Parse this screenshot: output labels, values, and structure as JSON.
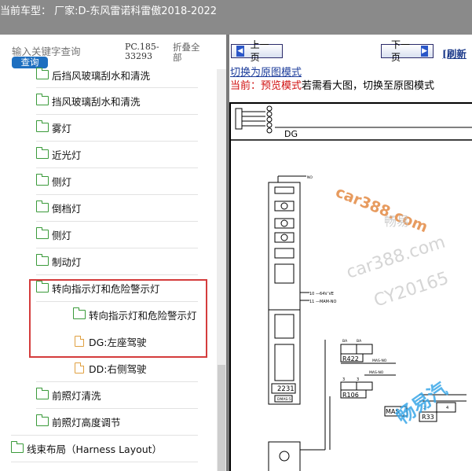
{
  "header": {
    "title": "当前车型：  厂家:D-东风雷诺科雷傲2018-2022"
  },
  "search": {
    "placeholder": "输入关键字查询",
    "button_label": "查询",
    "pc_code": "PC.185-33293",
    "collapse_all": "折叠全部"
  },
  "tree": {
    "items": [
      {
        "label": "后挡风玻璃刮水和清洗",
        "icon": "folder-icon"
      },
      {
        "label": "挡风玻璃刮水和清洗",
        "icon": "folder-icon"
      },
      {
        "label": "雾灯",
        "icon": "folder-icon"
      },
      {
        "label": "近光灯",
        "icon": "folder-icon"
      },
      {
        "label": "侧灯",
        "icon": "folder-icon"
      },
      {
        "label": "倒档灯",
        "icon": "folder-icon"
      },
      {
        "label": "侧灯",
        "icon": "folder-icon"
      },
      {
        "label": "制动灯",
        "icon": "folder-icon"
      },
      {
        "label": "转向指示灯和危险警示灯",
        "icon": "folder-open-icon"
      },
      {
        "label": "转向指示灯和危险警示灯",
        "icon": "folder-open-icon"
      },
      {
        "label": "DG:左座驾驶",
        "icon": "document-icon"
      },
      {
        "label": "DD:右侧驾驶",
        "icon": "document-icon"
      },
      {
        "label": "前照灯清洗",
        "icon": "folder-icon"
      },
      {
        "label": "前照灯高度调节",
        "icon": "folder-icon"
      },
      {
        "label": "线束布局（Harness Layout）",
        "icon": "folder-icon"
      }
    ]
  },
  "viewer": {
    "prev_label": "上一页",
    "next_label": "下一页",
    "refresh_label": "[刷新",
    "switch_link": "切换为原图模式",
    "hint_prefix": "当前：预览模式",
    "hint_rest": "若需看大图，切换至原图模式",
    "diagram": {
      "connector_label": "DG",
      "component_main": "2231",
      "component_main_sub": "DMAS-5",
      "relay_1": "R422",
      "relay_2": "R106",
      "relay_3": "R33",
      "box_4": "MAS",
      "wire_1": "10 —64V VE",
      "wire_2": "11 —MAM-NO",
      "wire_no": "NO",
      "pin_labels": [
        "BA",
        "BA",
        "MAS-NO",
        "MAS-NO",
        "3",
        "3",
        "4",
        "2"
      ],
      "watermark_1": "car388.com",
      "watermark_2": "畅易",
      "watermark_3": "car388.com",
      "watermark_4": "CY20165",
      "watermark_5": "畅易汽",
      "watermark_colors": {
        "orange": "#e07a2a",
        "gray": "#c4c4c4",
        "blue": "#3aa7e8"
      }
    }
  }
}
